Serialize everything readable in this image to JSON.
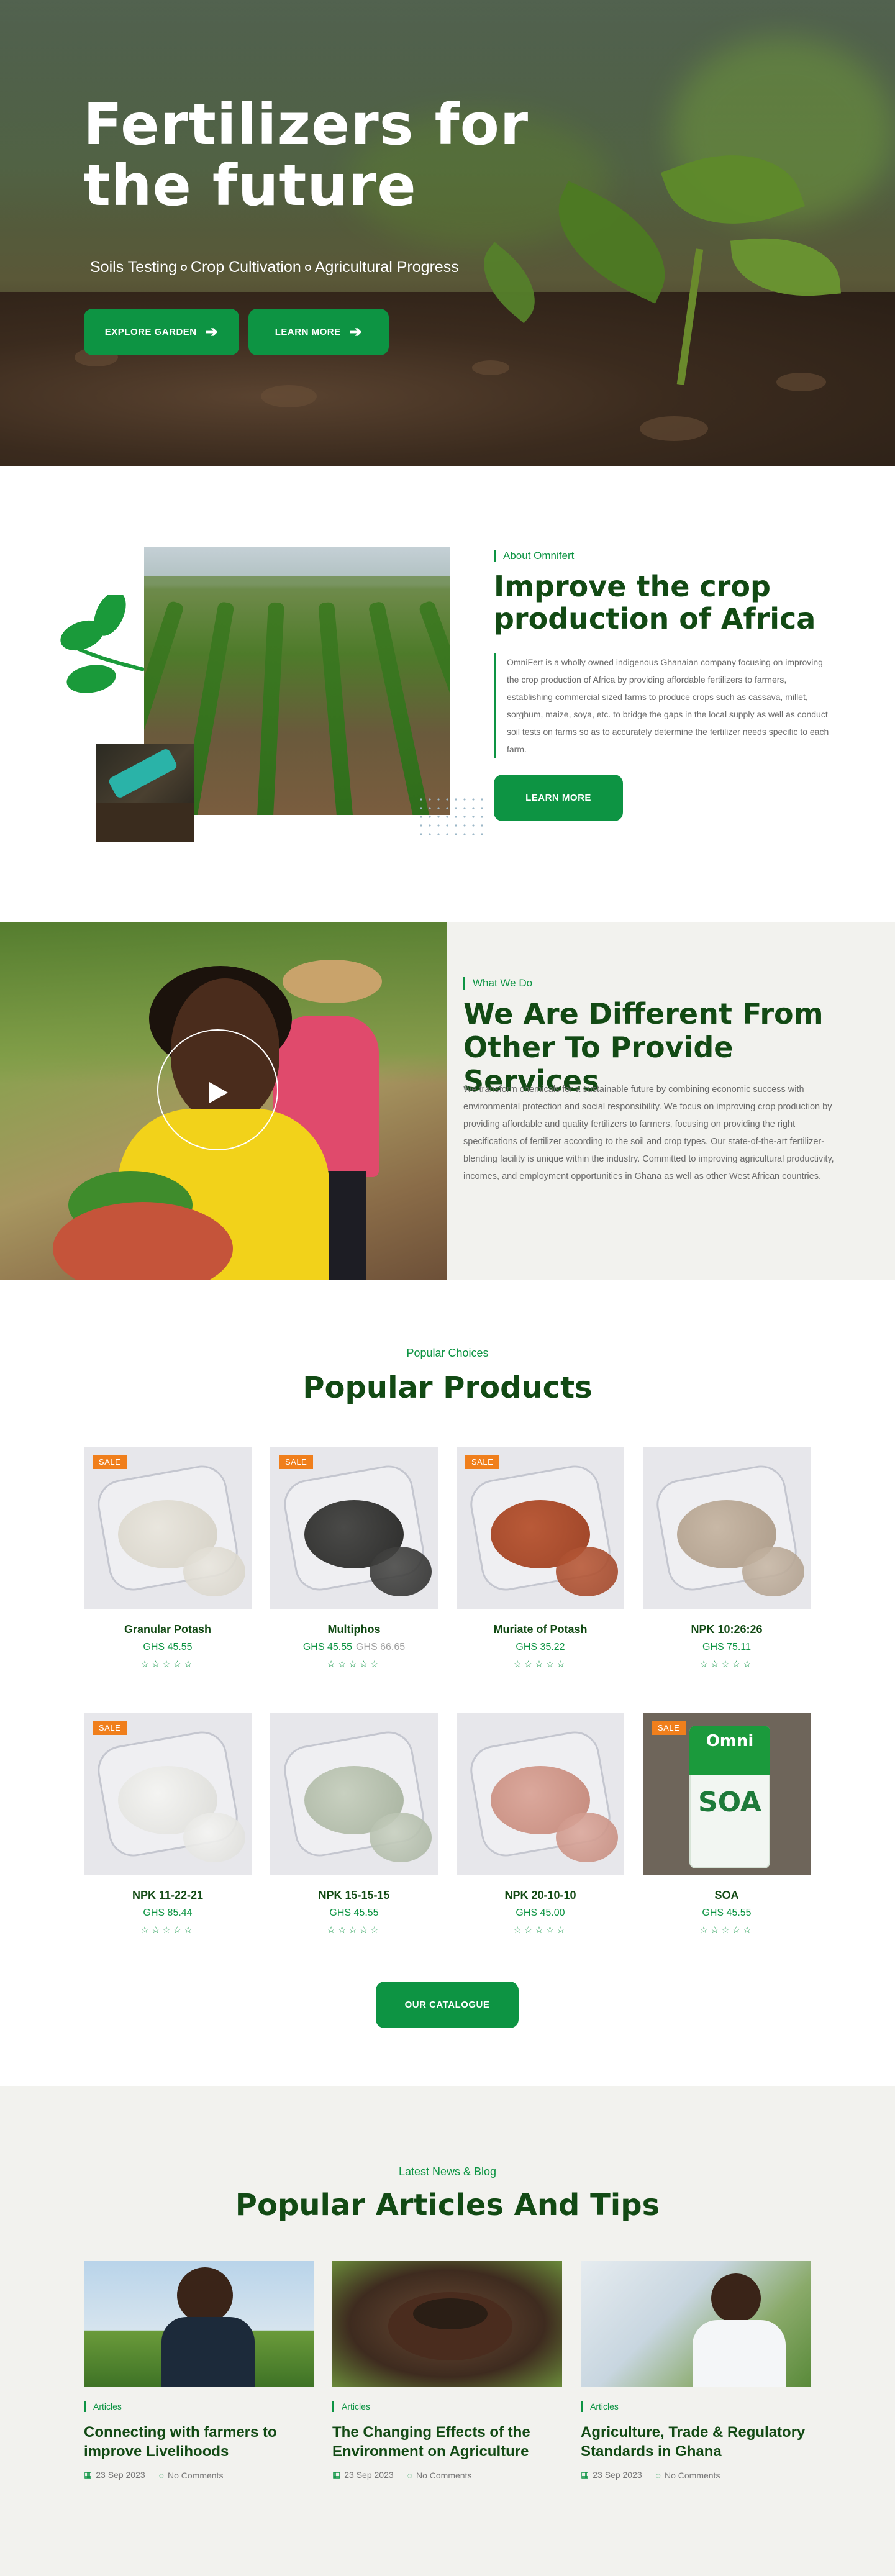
{
  "hero": {
    "title": "Fertilizers for the future",
    "subtitle_items": [
      "Soils Testing",
      "Crop Cultivation",
      "Agricultural Progress"
    ],
    "buttons": {
      "explore": "EXPLORE GARDEN",
      "learn": "LEARN MORE"
    }
  },
  "about": {
    "eyebrow": "About Omnifert",
    "title": "Improve the crop production of Africa",
    "text": "OmniFert is a wholly owned indigenous Ghanaian company focusing on improving the crop production of Africa by providing affordable fertilizers to farmers, establishing commercial sized farms to produce crops such as cassava, millet, sorghum, maize, soya, etc. to bridge the gaps in the local supply as well as conduct soil tests on farms so as to accurately determine the fertilizer needs specific to each farm.",
    "button": "LEARN MORE"
  },
  "different": {
    "eyebrow": "What We Do",
    "title": "We Are Different From Other To Provide Services",
    "text": "We transform chemicals for a sustainable future by combining economic success with environmental protection and social responsibility. We focus on improving crop production by providing affordable and quality fertilizers to farmers, focusing on providing the right specifications of fertilizer according to the soil and crop types. Our state-of-the-art fertilizer-blending facility is unique within the industry. Committed to improving agricultural productivity, incomes, and employment opportunities in Ghana as well as other West African countries."
  },
  "products": {
    "eyebrow": "Popular Choices",
    "title": "Popular Products",
    "sale_label": "SALE",
    "stars": "☆☆☆☆☆",
    "items": [
      {
        "name": "Granular Potash",
        "price": "GHS 45.55",
        "old_price": "",
        "sale": true,
        "color1": "#e9e6de",
        "color2": "#d5d1c6"
      },
      {
        "name": "Multiphos",
        "price": "GHS 45.55",
        "old_price": "GHS 66.65",
        "sale": true,
        "color1": "#4a4a48",
        "color2": "#2d2d2c"
      },
      {
        "name": "Muriate of Potash",
        "price": "GHS 35.22",
        "old_price": "",
        "sale": true,
        "color1": "#b95a38",
        "color2": "#9e4528"
      },
      {
        "name": "NPK 10:26:26",
        "price": "GHS 75.11",
        "old_price": "",
        "sale": false,
        "color1": "#c8b8a6",
        "color2": "#ad9c8a"
      },
      {
        "name": "NPK 11-22-21",
        "price": "GHS 85.44",
        "old_price": "",
        "sale": true,
        "color1": "#f4f4f2",
        "color2": "#dcdcd8"
      },
      {
        "name": "NPK 15-15-15",
        "price": "GHS 45.55",
        "old_price": "",
        "sale": false,
        "color1": "#c8d0c0",
        "color2": "#a8b3a0"
      },
      {
        "name": "NPK 20-10-10",
        "price": "GHS 45.00",
        "old_price": "",
        "sale": false,
        "color1": "#dba89c",
        "color2": "#c48a7c"
      },
      {
        "name": "SOA",
        "price": "GHS 45.55",
        "old_price": "",
        "sale": true,
        "color1": "#1b9a3c",
        "color2": "#f2f6f2"
      }
    ],
    "soa_bag": {
      "brand": "Omni",
      "label": "SOA"
    },
    "catalogue_button": "OUR CATALOGUE"
  },
  "blog": {
    "eyebrow": "Latest News & Blog",
    "title": "Popular Articles And Tips",
    "articles": [
      {
        "tag": "Articles",
        "title": "Connecting with farmers to improve Livelihoods",
        "date": "23 Sep 2023",
        "comments": "No Comments"
      },
      {
        "tag": "Articles",
        "title": "The Changing Effects of the Environment on Agriculture",
        "date": "23 Sep 2023",
        "comments": "No Comments"
      },
      {
        "tag": "Articles",
        "title": "Agriculture, Trade & Regulatory Standards in Ghana",
        "date": "23 Sep 2023",
        "comments": "No Comments"
      }
    ]
  }
}
